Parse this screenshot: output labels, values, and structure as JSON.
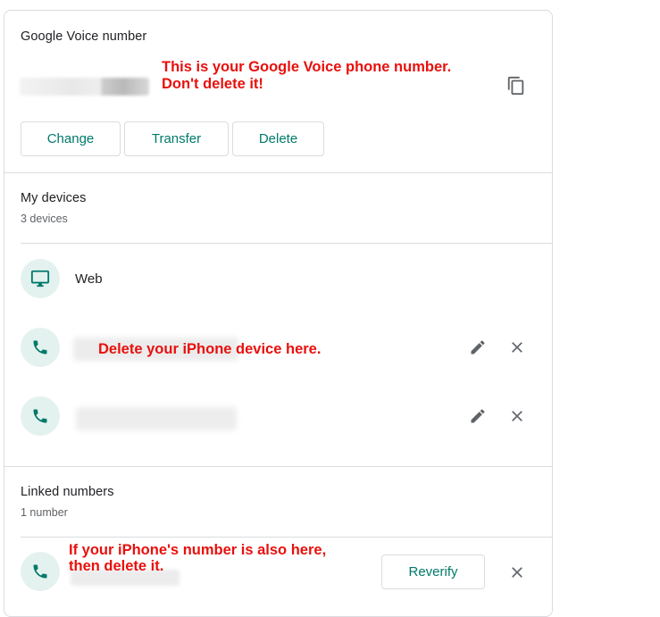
{
  "voice": {
    "title": "Google Voice number",
    "annotation_line1": "This is your Google Voice phone number.",
    "annotation_line2": "Don't delete it!",
    "buttons": {
      "change": "Change",
      "transfer": "Transfer",
      "delete": "Delete"
    }
  },
  "devices": {
    "title": "My devices",
    "count": "3 devices",
    "web_label": "Web",
    "annotation": "Delete your iPhone device here."
  },
  "linked": {
    "title": "Linked numbers",
    "count": "1 number",
    "annotation_line1": "If your iPhone's number is also here,",
    "annotation_line2": "then delete it.",
    "reverify": "Reverify"
  },
  "icons": {
    "copy": "copy-icon",
    "monitor": "monitor-icon",
    "phone": "phone-icon",
    "edit": "pencil-icon",
    "close": "close-icon"
  },
  "colors": {
    "accent": "#00796b",
    "annotation": "#e8100d",
    "icon_bg": "#e4f2ef"
  }
}
